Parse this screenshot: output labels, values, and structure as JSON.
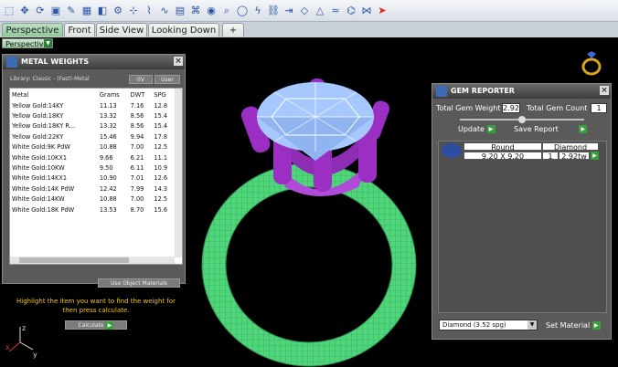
{
  "toolbar": {
    "icons": [
      "select-icon",
      "move-icon",
      "rotate-icon",
      "box-icon",
      "edit-icon",
      "grid-icon",
      "eraser-icon",
      "gear-icon",
      "snap-icon",
      "wire-icon",
      "curve-icon",
      "table-icon",
      "knot-icon",
      "render-icon",
      "zoom-icon",
      "ring-icon",
      "bolt-icon",
      "link-icon",
      "arrow-icon",
      "shape-icon",
      "mountain-icon",
      "wave-icon",
      "dna-icon",
      "net-icon",
      "red-arrow-icon"
    ]
  },
  "tabs": {
    "perspective": "Perspective",
    "front": "Front",
    "side": "Side View",
    "looking_down": "Looking Down",
    "add": "+"
  },
  "view_dropdown": "Perspective",
  "metal_weights": {
    "title": "METAL WEIGHTS",
    "library": "Library: Classic - (Fast)-Metal",
    "btn_0v": "0V",
    "btn_user": "User",
    "columns": [
      "Metal",
      "Grams",
      "DWT",
      "SPG"
    ],
    "rows": [
      [
        "Yellow Gold:14KY",
        "11.13",
        "7.16",
        "12.8"
      ],
      [
        "Yellow Gold:18KY",
        "13.32",
        "8.56",
        "15.4"
      ],
      [
        "Yellow Gold:18KY R...",
        "13.32",
        "8.56",
        "15.4"
      ],
      [
        "Yellow Gold:22KY",
        "15.46",
        "9.94",
        "17.8"
      ],
      [
        "White Gold:9K PdW",
        "10.88",
        "7.00",
        "12.5"
      ],
      [
        "White Gold:10KX1",
        "9.66",
        "6.21",
        "11.1"
      ],
      [
        "White Gold:10KW",
        "9.50",
        "6.11",
        "10.9"
      ],
      [
        "White Gold:14KX1",
        "10.90",
        "7.01",
        "12.6"
      ],
      [
        "White Gold:14K PdW",
        "12.42",
        "7.99",
        "14.3"
      ],
      [
        "White Gold:14KW",
        "10.88",
        "7.00",
        "12.5"
      ],
      [
        "White Gold:18K PdW",
        "13.53",
        "8.70",
        "15.6"
      ]
    ],
    "use_object": "Use Object Materials",
    "instruction": "Highlight the item you want to find the weight for then press calculate.",
    "calculate": "Calculate"
  },
  "gem_reporter": {
    "title": "GEM REPORTER",
    "total_weight_label": "Total Gem Weight",
    "total_weight": "2.92",
    "total_count_label": "Total Gem Count",
    "total_count": "1",
    "update": "Update",
    "save_report": "Save Report",
    "gem": {
      "shape": "Round",
      "size": "9.20 X 9.20",
      "material": "Diamond",
      "count": "1",
      "weight": "2.92tw"
    },
    "material_select": "Diamond     (3.52 spg)",
    "set_material": "Set Material"
  },
  "axes": {
    "x": "x",
    "y": "y",
    "z": "z"
  },
  "colors": {
    "band": "#4fd67a",
    "prongs": "#9b2fc4",
    "stone": "#a6c8ff",
    "background": "#000000",
    "instruction": "#f3c520"
  }
}
